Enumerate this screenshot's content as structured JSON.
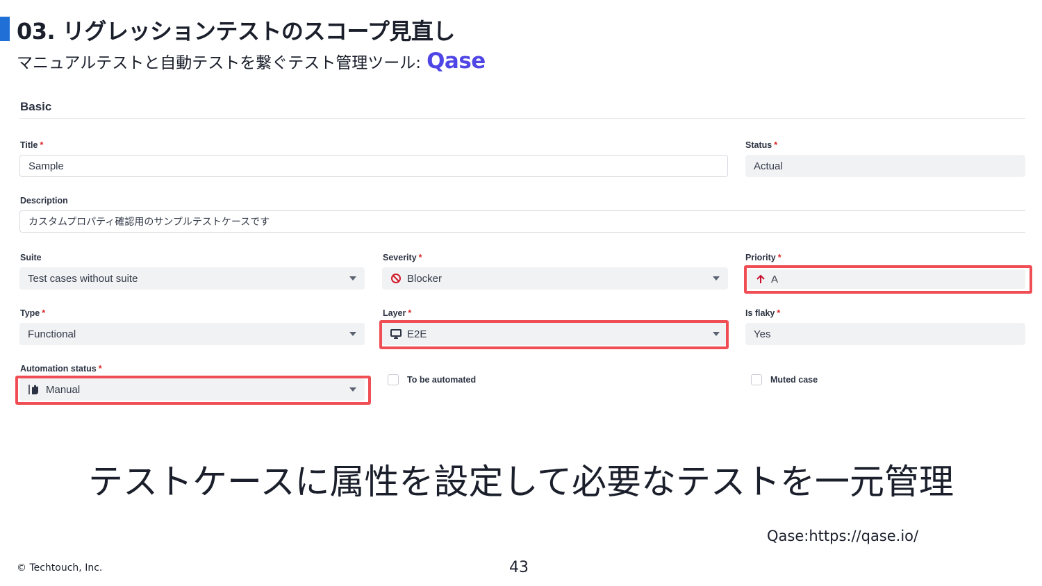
{
  "slide": {
    "title": "03. リグレッションテストのスコープ見直し",
    "subtitle": "マニュアルテストと自動テストを繋ぐテスト管理ツール:",
    "brand": "Qase",
    "headline": "テストケースに属性を設定して必要なテストを一元管理",
    "source": "Qase:https://qase.io/",
    "copyright": "© Techtouch, Inc.",
    "page_number": "43",
    "accent_color": "#1f6fd6",
    "brand_color": "#4f46e5",
    "highlight_color": "#ef4e55"
  },
  "form": {
    "section_title": "Basic",
    "required_mark": "*",
    "title": {
      "label": "Title",
      "value": "Sample"
    },
    "status": {
      "label": "Status",
      "value": "Actual"
    },
    "description": {
      "label": "Description",
      "value": "カスタムプロパティ確認用のサンプルテストケースです"
    },
    "suite": {
      "label": "Suite",
      "value": "Test cases without suite"
    },
    "severity": {
      "label": "Severity",
      "value": "Blocker",
      "icon": "blocker-icon"
    },
    "priority": {
      "label": "Priority",
      "value": "A",
      "icon": "arrow-up-icon"
    },
    "type": {
      "label": "Type",
      "value": "Functional"
    },
    "layer": {
      "label": "Layer",
      "value": "E2E",
      "icon": "monitor-icon"
    },
    "is_flaky": {
      "label": "Is flaky",
      "value": "Yes"
    },
    "automation_status": {
      "label": "Automation status",
      "value": "Manual",
      "icon": "hand-icon"
    },
    "to_be_automated": {
      "label": "To be automated",
      "checked": false
    },
    "muted_case": {
      "label": "Muted case",
      "checked": false
    }
  }
}
